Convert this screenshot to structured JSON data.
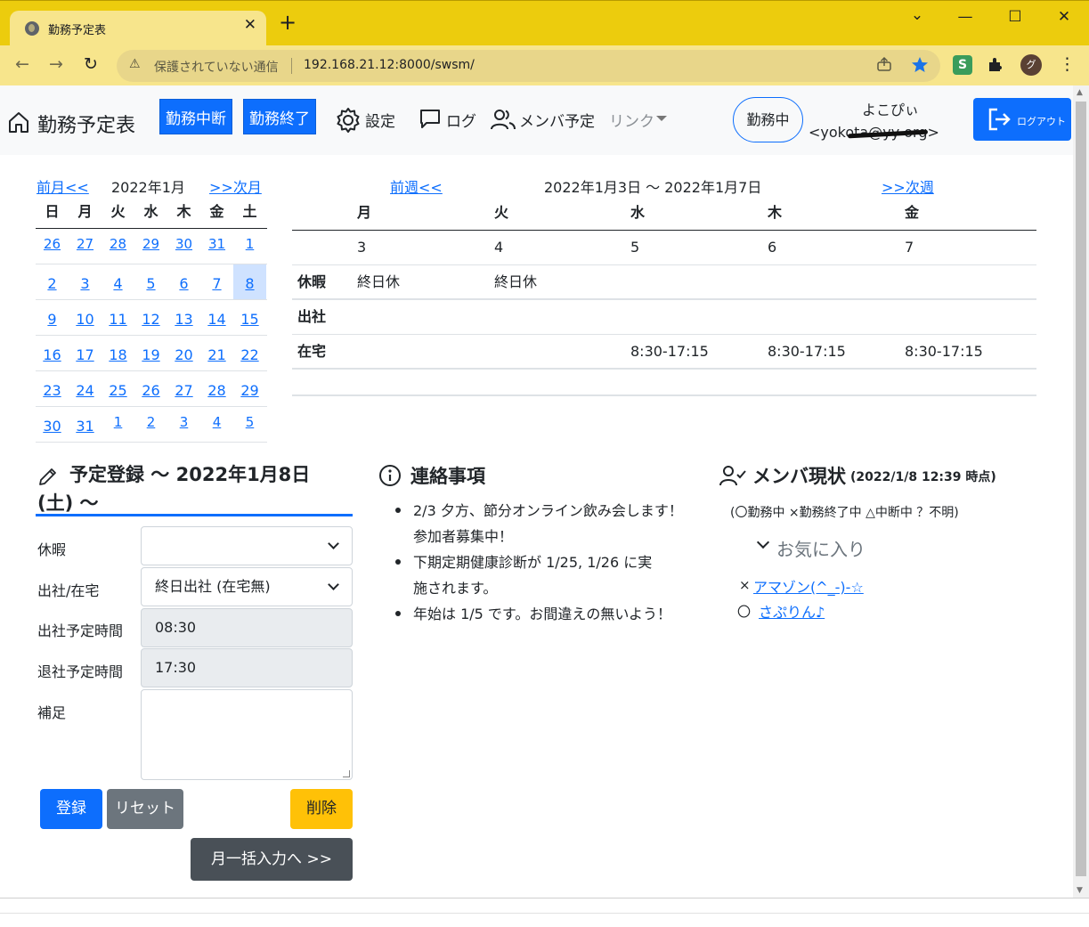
{
  "browser": {
    "tab_title": "勤務予定表",
    "tab_close": "✕",
    "new_tab": "+",
    "insecure_label": "保護されていない通信",
    "url": "192.168.21.12:8000/swsm/",
    "profile_initial": "グ",
    "extension_label": "S"
  },
  "nav": {
    "brand": "勤務予定表",
    "btn_pause": "勤務中断",
    "btn_end": "勤務終了",
    "settings": "設定",
    "log": "ログ",
    "member_schedule": "メンバ予定",
    "link": "リンク",
    "status": "勤務中",
    "user_name": "よこぴぃ",
    "user_mail": "<yokota@yy     org>",
    "logout": "ログアウト"
  },
  "calendar": {
    "prev": "前月<<",
    "month": "2022年1月",
    "next": ">>次月",
    "weekdays": [
      "日",
      "月",
      "火",
      "水",
      "木",
      "金",
      "土"
    ],
    "weeks": [
      [
        "26",
        "27",
        "28",
        "29",
        "30",
        "31",
        "1"
      ],
      [
        "2",
        "3",
        "4",
        "5",
        "6",
        "7",
        "8"
      ],
      [
        "9",
        "10",
        "11",
        "12",
        "13",
        "14",
        "15"
      ],
      [
        "16",
        "17",
        "18",
        "19",
        "20",
        "21",
        "22"
      ],
      [
        "23",
        "24",
        "25",
        "26",
        "27",
        "28",
        "29"
      ],
      [
        "30",
        "31",
        "1",
        "2",
        "3",
        "4",
        "5"
      ]
    ],
    "selected": "8"
  },
  "week": {
    "prev": "前週<<",
    "range": "2022年1月3日 〜 2022年1月7日",
    "next": ">>次週",
    "days": [
      "月",
      "火",
      "水",
      "木",
      "金"
    ],
    "dates": [
      "3",
      "4",
      "5",
      "6",
      "7"
    ],
    "rows": [
      {
        "label": "休暇",
        "cells": [
          "終日休",
          "終日休",
          "",
          "",
          ""
        ]
      },
      {
        "label": "出社",
        "cells": [
          "",
          "",
          "",
          "",
          ""
        ]
      },
      {
        "label": "在宅",
        "cells": [
          "",
          "",
          "8:30-17:15",
          "8:30-17:15",
          "8:30-17:15"
        ]
      }
    ]
  },
  "registration": {
    "title_line1": "予定登録 〜 2022年1月8日",
    "title_line2": "(土) 〜",
    "leave_label": "休暇",
    "leave_value": "",
    "office_label": "出社/在宅",
    "office_value": "終日出社 (在宅無)",
    "start_label": "出社予定時間",
    "start_value": "08:30",
    "end_label": "退社予定時間",
    "end_value": "17:30",
    "note_label": "補足",
    "note_value": "",
    "btn_register": "登録",
    "btn_reset": "リセット",
    "btn_delete": "削除",
    "btn_monthly": "月一括入力へ >>"
  },
  "notices": {
    "title": "連絡事項",
    "items": [
      {
        "line1": "2/3 夕方、節分オンライン飲み会します！",
        "line2": "参加者募集中！"
      },
      {
        "line1": "下期定期健康診断が 1/25, 1/26 に実",
        "line2": "施されます。"
      },
      {
        "line1": "年始は 1/5 です。お間違えの無いよう！",
        "line2": ""
      }
    ]
  },
  "members": {
    "title": "メンバ現状",
    "as_of": "(2022/1/8 12:39 時点)",
    "legend": "(〇勤務中 ×勤務終了中 △中断中 ？不明)",
    "favorites": "お気に入り",
    "list": [
      {
        "mark": "×",
        "name": "アマゾン(^_-)-☆"
      },
      {
        "mark": "〇",
        "name": "さぷりん♪"
      }
    ]
  },
  "colors": {
    "primary": "#0d6efd",
    "secondary": "#6c757d",
    "warning": "#ffc107",
    "dark": "#495057",
    "chrome": "#eccc0d"
  }
}
